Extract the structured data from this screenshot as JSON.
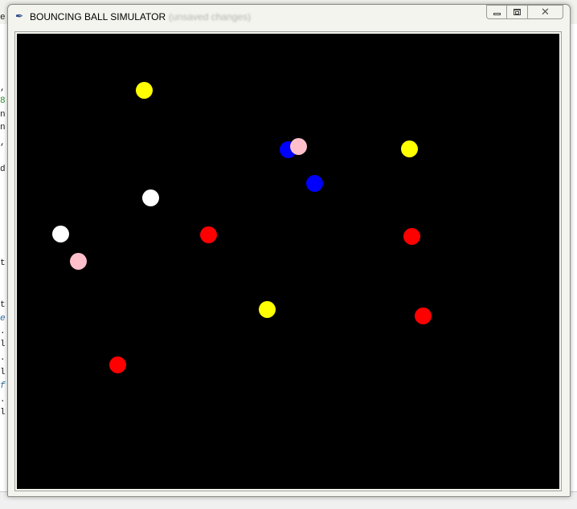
{
  "background_app": {
    "code_fragments": [
      "e",
      ",",
      "8",
      "n",
      "n",
      ",",
      "d",
      "t",
      "t",
      "e",
      ".",
      "l",
      ".",
      "l",
      "f",
      ".",
      "l"
    ]
  },
  "window": {
    "title": "BOUNCING BALL SIMULATOR",
    "ghost_title": "(unsaved changes)",
    "icon": "feather-icon",
    "controls": {
      "minimize": "minimize-icon",
      "maximize": "maximize-icon",
      "close": "close-icon",
      "close_glyph": "✕"
    }
  },
  "simulation": {
    "background": "#000000",
    "balls": [
      {
        "color": "#ffff00",
        "label": "yellow"
      },
      {
        "color": "#0000ff",
        "label": "blue"
      },
      {
        "color": "#ffc0cb",
        "label": "pink"
      },
      {
        "color": "#ffff00",
        "label": "yellow"
      },
      {
        "color": "#0000ff",
        "label": "blue"
      },
      {
        "color": "#ffffff",
        "label": "white"
      },
      {
        "color": "#ff0000",
        "label": "red"
      },
      {
        "color": "#ff0000",
        "label": "red"
      },
      {
        "color": "#ffffff",
        "label": "white"
      },
      {
        "color": "#ffc0cb",
        "label": "pink"
      },
      {
        "color": "#ffff00",
        "label": "yellow"
      },
      {
        "color": "#ff0000",
        "label": "red"
      },
      {
        "color": "#ff0000",
        "label": "red"
      }
    ]
  }
}
